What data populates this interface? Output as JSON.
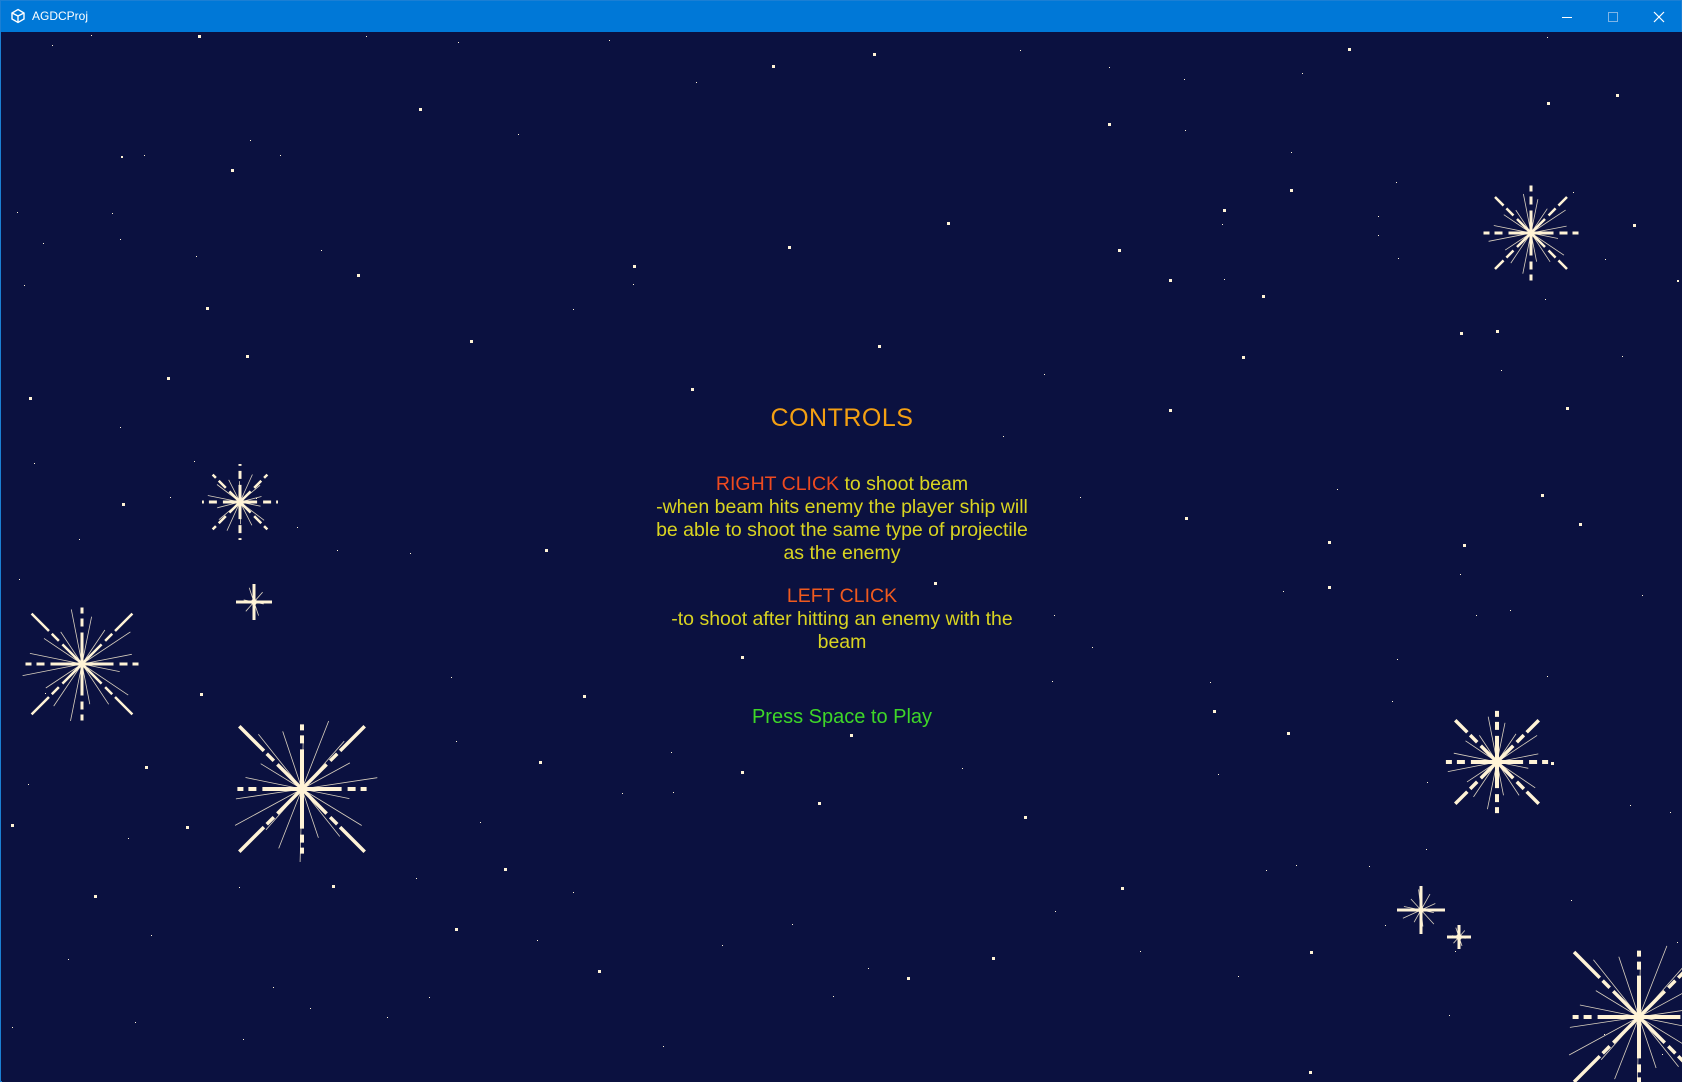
{
  "window": {
    "title": "AGDCProj",
    "app_icon": "unity-logo-icon",
    "buttons": {
      "minimize_icon": "minimize-icon",
      "maximize_icon": "maximize-icon",
      "close_icon": "close-icon"
    }
  },
  "colors": {
    "titlebar": "#0078d7",
    "background": "#0b1140",
    "title_text": "#f4a012",
    "key_text": "#ef4a1f",
    "body_text": "#d9d421",
    "prompt_text": "#3ed628",
    "star": "#fff3d6"
  },
  "controls": {
    "title": "CONTROLS",
    "right_click": {
      "key": "RIGHT CLICK",
      "inline": " to shoot beam",
      "lines": [
        "-when beam hits enemy the player ship will",
        "be able to shoot the same type of projectile",
        "as the enemy"
      ]
    },
    "left_click": {
      "key": "LEFT CLICK",
      "lines": [
        "-to shoot after hitting an enemy with the",
        "beam"
      ]
    },
    "play_prompt": "Press Space to Play"
  }
}
